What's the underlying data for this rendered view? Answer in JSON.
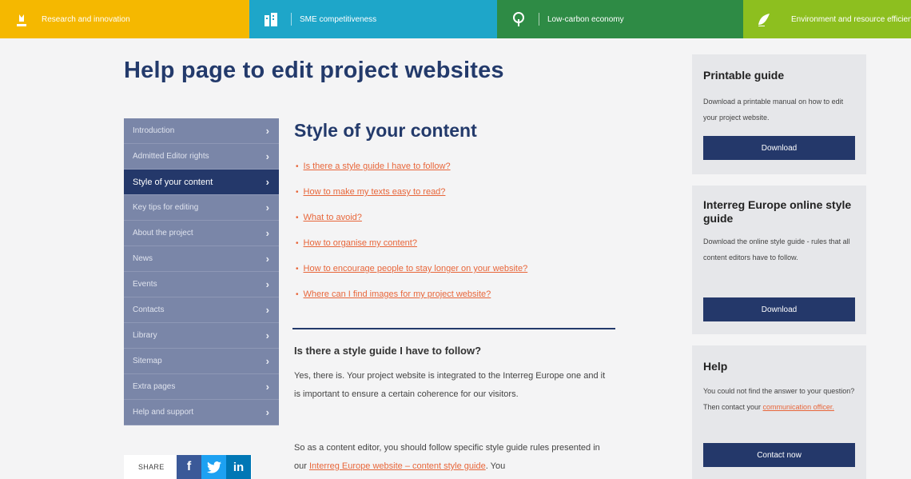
{
  "themes": [
    {
      "label": "Research and innovation",
      "icon": "lightbulb-icon",
      "color": "#f5b800",
      "width": 312
    },
    {
      "label": "SME competitiveness",
      "icon": "buildings-icon",
      "color": "#1ea6c9",
      "width": 310
    },
    {
      "label": "Low-carbon economy",
      "icon": "tree-icon",
      "color": "#2e8b45",
      "width": 308
    },
    {
      "label": "Environment and resource efficiency",
      "icon": "leaf-icon",
      "color": "#8dbf1f",
      "width": 210
    }
  ],
  "page_title": "Help page to edit project websites",
  "sidebar": {
    "items": [
      {
        "label": "Introduction",
        "active": false
      },
      {
        "label": "Admitted Editor rights",
        "active": false
      },
      {
        "label": "Style of your content",
        "active": true
      },
      {
        "label": "Key tips for editing",
        "active": false
      },
      {
        "label": "About the project",
        "active": false
      },
      {
        "label": "News",
        "active": false
      },
      {
        "label": "Events",
        "active": false
      },
      {
        "label": "Contacts",
        "active": false
      },
      {
        "label": "Library",
        "active": false
      },
      {
        "label": "Sitemap",
        "active": false
      },
      {
        "label": "Extra pages",
        "active": false
      },
      {
        "label": "Help and support",
        "active": false
      }
    ]
  },
  "share": {
    "label": "SHARE",
    "icons": [
      "facebook-icon",
      "twitter-icon",
      "linkedin-icon"
    ]
  },
  "content": {
    "title": "Style of your content",
    "toc": [
      "Is there a style guide I have to follow?",
      "How to make my texts easy to read?",
      "What to avoid?",
      "How to organise my content?",
      "How to encourage people to stay longer on your website?",
      "Where can I find images for my project website?"
    ],
    "section_heading": "Is there a style guide I have to follow?",
    "para1": "Yes, there is. Your project website is integrated to the Interreg Europe one and it is important to ensure a certain coherence for our visitors.",
    "para2_before": "So as a content editor, you should follow specific style guide rules presented in our ",
    "para2_link": "Interreg Europe website – content style guide",
    "para2_after": ". You"
  },
  "cards": {
    "printable": {
      "title": "Printable guide",
      "text": "Download a printable manual on how to edit your project website.",
      "button": "Download"
    },
    "style_guide": {
      "title": "Interreg Europe online style guide",
      "text": "Download the online style guide - rules that all content editors have to follow.",
      "button": "Download"
    },
    "help": {
      "title": "Help",
      "text_before": "You could not find the answer to your question? Then contact your ",
      "text_link": "communication officer.",
      "button": "Contact now"
    }
  }
}
